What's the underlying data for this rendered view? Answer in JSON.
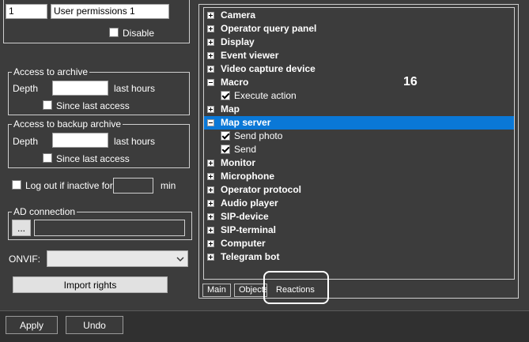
{
  "top": {
    "index_value": "1",
    "name_value": "User permissions 1",
    "disable_label": "Disable"
  },
  "archive": {
    "legend": "Access to archive",
    "depth_label": "Depth",
    "depth_value": "",
    "unit_label": "last hours",
    "since_label": "Since last access"
  },
  "backup": {
    "legend": "Access to backup archive",
    "depth_label": "Depth",
    "depth_value": "",
    "unit_label": "last hours",
    "since_label": "Since last access"
  },
  "logout": {
    "label": "Log out if inactive for",
    "value": "",
    "unit": "min"
  },
  "ad": {
    "legend": "AD connection",
    "browse_label": "...",
    "value": ""
  },
  "onvif": {
    "label": "ONVIF:",
    "selected": ""
  },
  "import_label": "Import rights",
  "tree": [
    {
      "label": "Camera",
      "type": "node",
      "expanded": false
    },
    {
      "label": "Operator query panel",
      "type": "node",
      "expanded": false
    },
    {
      "label": "Display",
      "type": "node",
      "expanded": false
    },
    {
      "label": "Event viewer",
      "type": "node",
      "expanded": false
    },
    {
      "label": "Video capture device",
      "type": "node",
      "expanded": false
    },
    {
      "label": "Macro",
      "type": "node",
      "expanded": true
    },
    {
      "label": "Execute action",
      "type": "leaf",
      "checked": true
    },
    {
      "label": "Map",
      "type": "node",
      "expanded": false
    },
    {
      "label": "Map server",
      "type": "node",
      "expanded": true,
      "selected": true
    },
    {
      "label": "Send photo",
      "type": "leaf",
      "checked": true
    },
    {
      "label": "Send",
      "type": "leaf",
      "checked": true
    },
    {
      "label": "Monitor",
      "type": "node",
      "expanded": false
    },
    {
      "label": "Microphone",
      "type": "node",
      "expanded": false
    },
    {
      "label": "Operator protocol",
      "type": "node",
      "expanded": false
    },
    {
      "label": "Audio player",
      "type": "node",
      "expanded": false
    },
    {
      "label": "SIP-device",
      "type": "node",
      "expanded": false
    },
    {
      "label": "SIP-terminal",
      "type": "node",
      "expanded": false
    },
    {
      "label": "Computer",
      "type": "node",
      "expanded": false
    },
    {
      "label": "Telegram bot",
      "type": "node",
      "expanded": false
    }
  ],
  "callout_number": "16",
  "tabs": [
    {
      "label": "Main"
    },
    {
      "label": "Objects"
    },
    {
      "label": "Reactions"
    }
  ],
  "footer": {
    "apply_label": "Apply",
    "undo_label": "Undo"
  },
  "colors": {
    "selection": "#0a78d7",
    "highlight_frame": "#ffffff"
  }
}
